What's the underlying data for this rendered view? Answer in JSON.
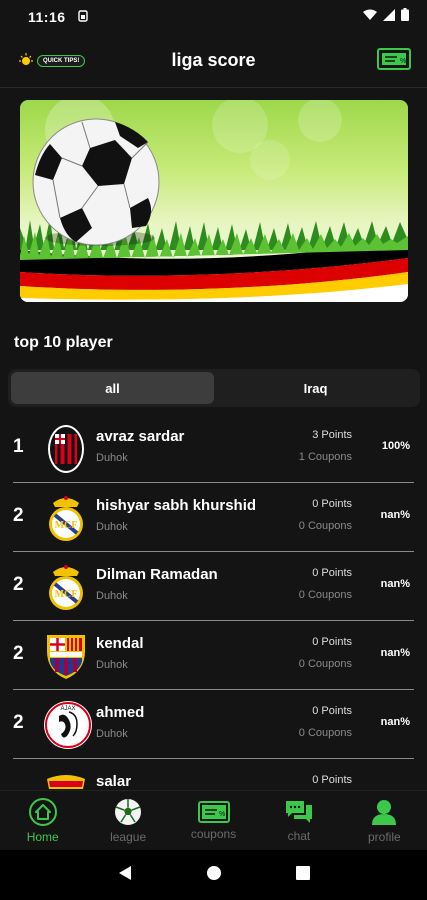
{
  "status": {
    "time": "11:16"
  },
  "appbar": {
    "title": "liga score",
    "tips_label": "QUICK TIPS!"
  },
  "section": {
    "title": "top 10 player"
  },
  "tabs": [
    {
      "label": "all"
    },
    {
      "label": "Iraq"
    }
  ],
  "players": [
    {
      "rank": "1",
      "name": "avraz sardar",
      "city": "Duhok",
      "points": "3 Points",
      "coupons": "1 Coupons",
      "pct": "100%",
      "club": "ac-milan"
    },
    {
      "rank": "2",
      "name": "hishyar sabh khurshid",
      "city": "Duhok",
      "points": "0 Points",
      "coupons": "0 Coupons",
      "pct": "nan%",
      "club": "real-madrid"
    },
    {
      "rank": "2",
      "name": "Dilman Ramadan",
      "city": "Duhok",
      "points": "0 Points",
      "coupons": "0 Coupons",
      "pct": "nan%",
      "club": "real-madrid"
    },
    {
      "rank": "2",
      "name": "kendal",
      "city": "Duhok",
      "points": "0 Points",
      "coupons": "0 Coupons",
      "pct": "nan%",
      "club": "barcelona"
    },
    {
      "rank": "2",
      "name": "ahmed",
      "city": "Duhok",
      "points": "0 Points",
      "coupons": "0 Coupons",
      "pct": "nan%",
      "club": "ajax"
    },
    {
      "rank": "",
      "name": "salar",
      "city": "",
      "points": "0 Points",
      "coupons": "",
      "pct": "",
      "club": "man-united"
    }
  ],
  "nav": [
    {
      "label": "Home",
      "icon": "home-icon"
    },
    {
      "label": "league",
      "icon": "ball-icon"
    },
    {
      "label": "coupons",
      "icon": "coupon-icon"
    },
    {
      "label": "chat",
      "icon": "chat-icon"
    },
    {
      "label": "profile",
      "icon": "profile-icon"
    }
  ],
  "colors": {
    "accent": "#3cc84a",
    "background": "#141414",
    "active_tab": "#3d3d3d"
  }
}
